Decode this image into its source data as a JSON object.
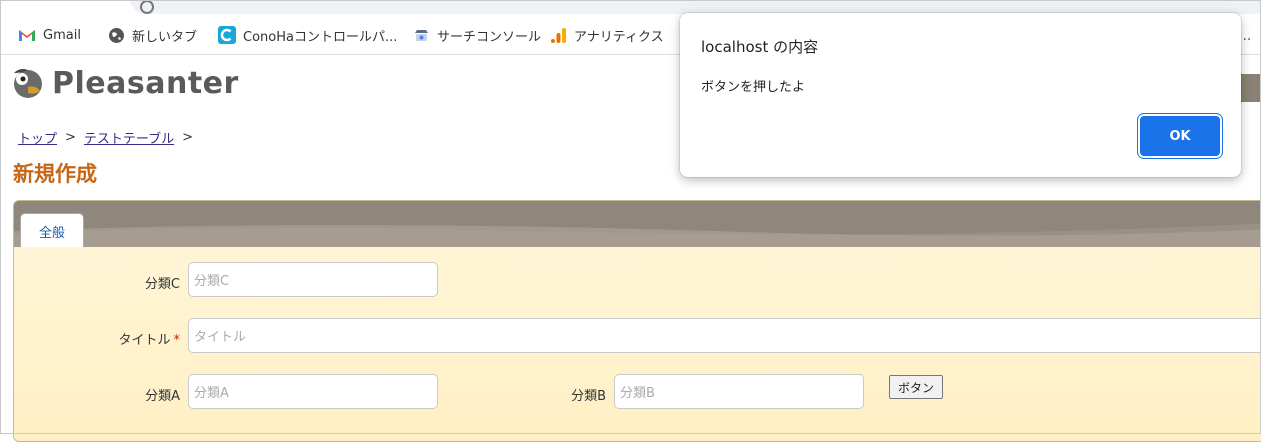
{
  "bookmarks": [
    {
      "label": "Gmail",
      "icon": "gmail-icon"
    },
    {
      "label": "新しいタブ",
      "icon": "globe-icon"
    },
    {
      "label": "ConoHaコントロールパ...",
      "icon": "conoha-icon"
    },
    {
      "label": "サーチコンソール",
      "icon": "search-console-icon"
    },
    {
      "label": "アナリティクス",
      "icon": "analytics-icon"
    }
  ],
  "bookmarks_overflow": "...",
  "app": {
    "logo": "Pleasanter"
  },
  "breadcrumb": {
    "top": "トップ",
    "table": "テストテーブル",
    "sep": ">"
  },
  "page_title": "新規作成",
  "tab_label": "全般",
  "form": {
    "classC": {
      "label": "分類C",
      "placeholder": "分類C"
    },
    "title": {
      "label": "タイトル",
      "required": "*",
      "placeholder": "タイトル"
    },
    "classA": {
      "label": "分類A",
      "placeholder": "分類A"
    },
    "classB": {
      "label": "分類B",
      "placeholder": "分類B"
    },
    "button": "ボタン"
  },
  "dialog": {
    "title": "localhost の内容",
    "message": "ボタンを押したよ",
    "ok": "OK"
  },
  "colors": {
    "accent": "#1a73e8",
    "page_title": "#c86617",
    "tab_bar": "#9a9185",
    "form_bg": "#fff3cf"
  }
}
